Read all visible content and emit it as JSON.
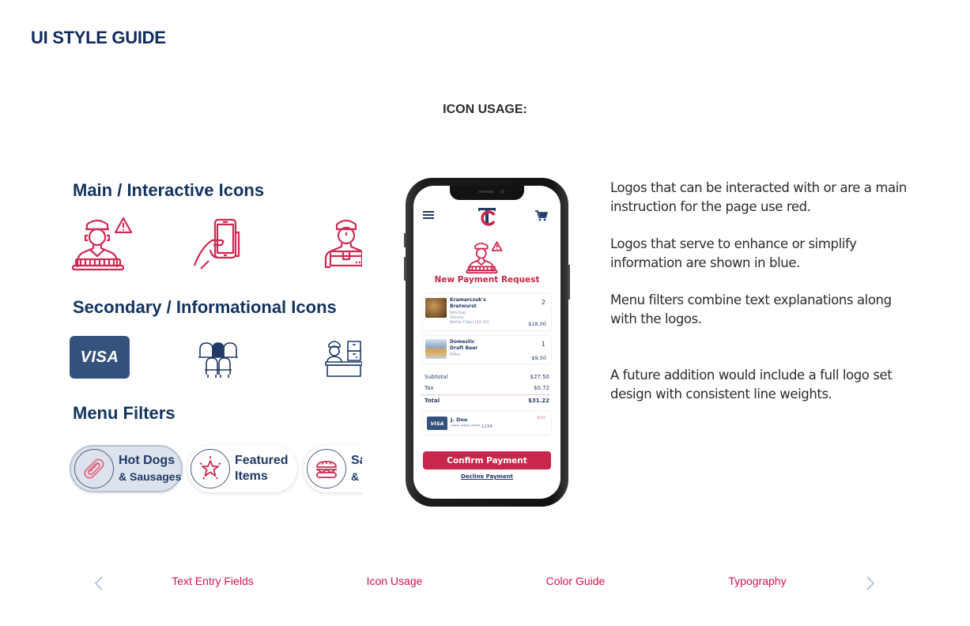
{
  "header": {
    "title": "UI STYLE GUIDE"
  },
  "section": {
    "title": "ICON USAGE:"
  },
  "colors": {
    "red": "#c8264a",
    "navy": "#13335f",
    "nav_link": "#d4144c",
    "arrow": "#b3c7e6"
  },
  "left_panel": {
    "main_heading": "Main / Interactive Icons",
    "main_icons": [
      "vendor-alert-icon",
      "hand-phone-icon",
      "delivery-person-icon"
    ],
    "secondary_heading": "Secondary / Informational Icons",
    "secondary_icons": [
      "visa-card-icon",
      "stadium-seats-icon",
      "concession-stand-icon"
    ],
    "visa_label": "VISA",
    "filters_heading": "Menu Filters",
    "filters": [
      {
        "line1": "Hot Dogs",
        "line2": "& Sausages",
        "icon": "hot-dog-icon",
        "active": true
      },
      {
        "line1": "Featured",
        "line2": "Items",
        "icon": "star-icon",
        "active": false
      },
      {
        "line1": "Sa",
        "line2": "& I",
        "icon": "sandwich-icon",
        "active": false
      }
    ]
  },
  "phone": {
    "screen_title": "New Payment Request",
    "items": [
      {
        "name_line1": "Kramarczuk's",
        "name_line2": "Bratwurst",
        "options": [
          "Ketchup",
          "Onions",
          "Kettle Chips  ($2.50)"
        ],
        "qty": "2",
        "price": "$18.00"
      },
      {
        "name_line1": "Domestic",
        "name_line2": "Draft Beer",
        "options": [
          "Miller"
        ],
        "qty": "1",
        "price": "$9.50"
      }
    ],
    "summary": {
      "subtotal_label": "Subtotal",
      "subtotal": "$27.50",
      "tax_label": "Tax",
      "tax": "$0.72",
      "total_label": "Total",
      "total": "$31.22"
    },
    "payment_card": {
      "brand": "VISA",
      "holder": "J. Doe",
      "number": "****-****-****-1234",
      "edit_label": "Edit"
    },
    "confirm_label": "Confirm Payment",
    "decline_label": "Decline Payment"
  },
  "description": [
    "Logos that can be interacted with or are a main instruction for the page use red.",
    "Logos that serve to enhance or simplify information are shown in blue.",
    "Menu filters combine text explanations along with the logos.",
    "A future addition would include a full logo set design with consistent line weights."
  ],
  "nav": {
    "prev_icon": "chevron-left-icon",
    "next_icon": "chevron-right-icon",
    "links": [
      "Text Entry Fields",
      "Icon Usage",
      "Color Guide",
      "Typography"
    ]
  }
}
